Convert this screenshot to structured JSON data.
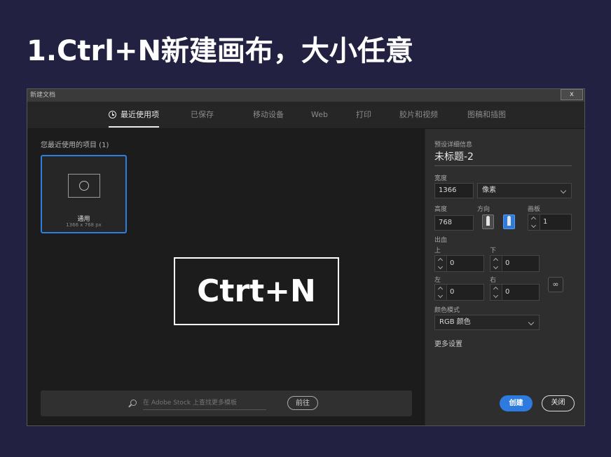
{
  "slide": {
    "title": "1.Ctrl+N新建画布，大小任意"
  },
  "dialog": {
    "title": "新建文档",
    "close_label": "x",
    "tabs": [
      "最近使用项",
      "已保存",
      "移动设备",
      "Web",
      "打印",
      "胶片和视频",
      "图稿和插图"
    ],
    "active_tab": 0
  },
  "recent": {
    "label": "您最近使用的项目 (1)",
    "items": [
      {
        "name": "通用",
        "dims": "1366 x 768 px",
        "icon": "globe-icon"
      }
    ]
  },
  "overlay": {
    "text": "Ctrt+N"
  },
  "stock": {
    "placeholder": "在 Adobe Stock 上查找更多模板",
    "go_label": "前往"
  },
  "details": {
    "header": "预设详细信息",
    "doc_name": "未标题-2",
    "width_label": "宽度",
    "width_value": "1366",
    "unit": "像素",
    "height_label": "高度",
    "height_value": "768",
    "orientation_label": "方向",
    "artboards_label": "画板",
    "artboards_value": "1",
    "bleed_label": "出血",
    "top_label": "上",
    "top_value": "0",
    "bottom_label": "下",
    "bottom_value": "0",
    "left_label": "左",
    "left_value": "0",
    "right_label": "右",
    "right_value": "0",
    "color_mode_label": "颜色模式",
    "color_mode_value": "RGB 颜色",
    "more_settings": "更多设置",
    "create_label": "创建",
    "close_label": "关闭",
    "accent_color": "#2e7be0"
  }
}
